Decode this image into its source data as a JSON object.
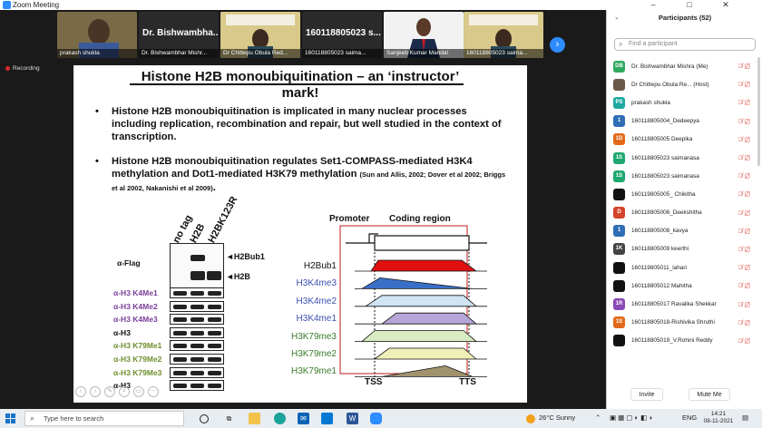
{
  "window": {
    "title": "Zoom Meeting",
    "minimize": "–",
    "maximize": "□",
    "close": "✕"
  },
  "videos": [
    {
      "name": "prakash shukla",
      "big": ""
    },
    {
      "name": "Dr. Bishwambhar Mishr...",
      "big": "Dr. Bishwambha..."
    },
    {
      "name": "Dr Chittepu Obula Red...",
      "big": ""
    },
    {
      "name": "160118805023 saima...",
      "big": "160118805023 s..."
    },
    {
      "name": "Sanjeeb Kumar Mandal",
      "big": ""
    },
    {
      "name": "160118805023 saima...",
      "big": ""
    }
  ],
  "recording": "Recording",
  "slide": {
    "title_line1": "Histone H2B monoubiquitination – an ‘instructor’",
    "title_line2": "mark!",
    "bullet1": "Histone H2B monoubiquitination is implicated in many nuclear processes including replication, recombination and repair, but well studied in the context of transcription.",
    "bullet2_main": "Histone H2B monoubiquitination regulates Set1-COMPASS-mediated H3K4 methylation and Dot1-mediated H3K79 methylation",
    "bullet2_refs": "(Sun and Allis, 2002; Dover et al 2002; Briggs et al 2002, Nakanishi et al 2009)",
    "bullet2_end": ".",
    "lanes": [
      "no tag",
      "H2B",
      "H2BK123R"
    ],
    "flag_label": "α-Flag",
    "arrow_h2bub1": "◄H2Bub1",
    "arrow_h2b": "◄H2B",
    "blot_rows": [
      {
        "label": "α-H3 K4Me1",
        "color": "#7a3e9a"
      },
      {
        "label": "α-H3 K4Me2",
        "color": "#7a3e9a"
      },
      {
        "label": "α-H3 K4Me3",
        "color": "#7a3e9a"
      },
      {
        "label": "α-H3",
        "color": "#111111"
      },
      {
        "label": "α-H3 K79Me1",
        "color": "#6f8f2e"
      },
      {
        "label": "α-H3 K79Me2",
        "color": "#6f8f2e"
      },
      {
        "label": "α-H3 K79Me3",
        "color": "#6f8f2e"
      },
      {
        "label": "α-H3",
        "color": "#111111"
      }
    ],
    "promoter": "Promoter",
    "coding_region": "Coding region",
    "tss": "TSS",
    "tts": "TTS",
    "tracks": [
      {
        "label": "H2Bub1",
        "color": "#111111",
        "fill": "#e01010"
      },
      {
        "label": "H3K4me3",
        "color": "#3b4fb0",
        "fill": "#3a6fc8"
      },
      {
        "label": "H3K4me2",
        "color": "#3b4fb0",
        "fill": "#cfe4f4"
      },
      {
        "label": "H3K4me1",
        "color": "#3b4fb0",
        "fill": "#b7a6d8"
      },
      {
        "label": "H3K79me3",
        "color": "#3a7a2a",
        "fill": "#d7ecc2"
      },
      {
        "label": "H3K79me2",
        "color": "#3a7a2a",
        "fill": "#eef0b8"
      },
      {
        "label": "H3K79me1",
        "color": "#3a7a2a",
        "fill": "#a0926c"
      }
    ]
  },
  "participants": {
    "title": "Participants (52)",
    "search_placeholder": "Find a participant",
    "items": [
      {
        "initials": "DB",
        "color": "#2eaa5e",
        "name": "Dr. Bishwambhar Mishra (Me)"
      },
      {
        "initials": "",
        "color": "#6a5a4a",
        "name": "Dr Chittepu Obula Re... (Host)"
      },
      {
        "initials": "PS",
        "color": "#1fa8a0",
        "name": "prakash shukla"
      },
      {
        "initials": "1",
        "color": "#2f6db5",
        "name": "160118805004_Dedeepya"
      },
      {
        "initials": "1D",
        "color": "#e06a1a",
        "name": "160118805005 Deepika"
      },
      {
        "initials": "1S",
        "color": "#1fa870",
        "name": "160118805023 saimanasa"
      },
      {
        "initials": "1S",
        "color": "#1fa870",
        "name": "160118805023 saimanasa"
      },
      {
        "initials": "",
        "color": "#111111",
        "name": "160119805005_ Chikitha"
      },
      {
        "initials": "D",
        "color": "#d2452a",
        "name": "160118805006_Deekshitha"
      },
      {
        "initials": "1",
        "color": "#2f6db5",
        "name": "160118805008_kavya"
      },
      {
        "initials": "1K",
        "color": "#444444",
        "name": "160118805009 keerthi"
      },
      {
        "initials": "",
        "color": "#111111",
        "name": "160119805011_lahari"
      },
      {
        "initials": "",
        "color": "#111111",
        "name": "160118805012 Mahitha"
      },
      {
        "initials": "1R",
        "color": "#8a4ab5",
        "name": "160118805017 Ravalika Shekkar"
      },
      {
        "initials": "1S",
        "color": "#e06a1a",
        "name": "160118805018-Rishivika Shruthi"
      },
      {
        "initials": "",
        "color": "#111111",
        "name": "160118805019_V.Rohini Reddy"
      }
    ],
    "invite": "Invite",
    "mute_me": "Mute Me"
  },
  "taskbar": {
    "search_placeholder": "Type here to search",
    "weather": "26°C  Sunny",
    "lang": "ENG",
    "time": "14:21",
    "date": "08-11-2021"
  }
}
